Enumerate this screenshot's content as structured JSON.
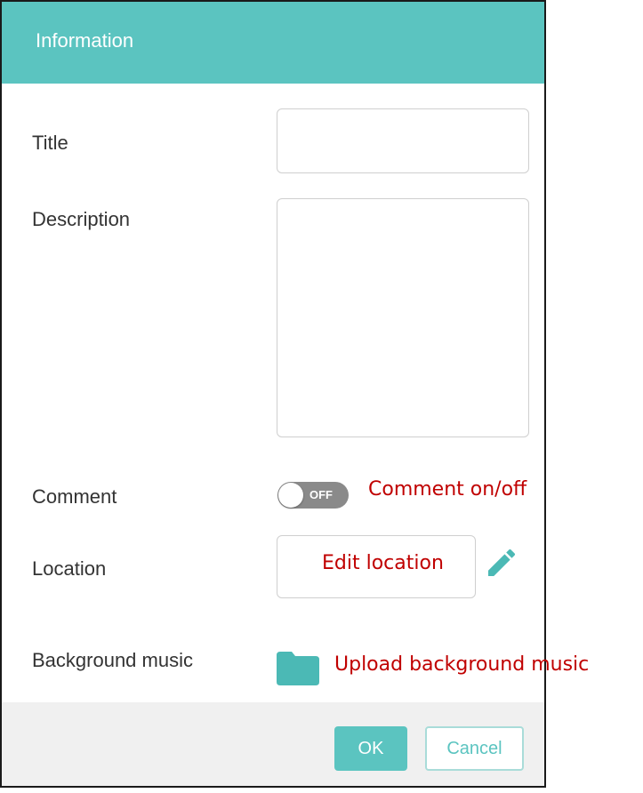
{
  "dialog": {
    "title": "Information",
    "accent_color": "#5bc4c0"
  },
  "fields": {
    "title_label": "Title",
    "title_value": "",
    "description_label": "Description",
    "description_value": "",
    "comment_label": "Comment",
    "comment_toggle_state": "OFF",
    "location_label": "Location",
    "location_value": "",
    "music_label": "Background music"
  },
  "annotations": {
    "comment": "Comment on/off",
    "location": "Edit location",
    "music": "Upload background music",
    "color": "#c00000"
  },
  "icons": {
    "edit": "pencil-icon",
    "upload": "folder-icon"
  },
  "footer": {
    "ok_label": "OK",
    "cancel_label": "Cancel"
  }
}
